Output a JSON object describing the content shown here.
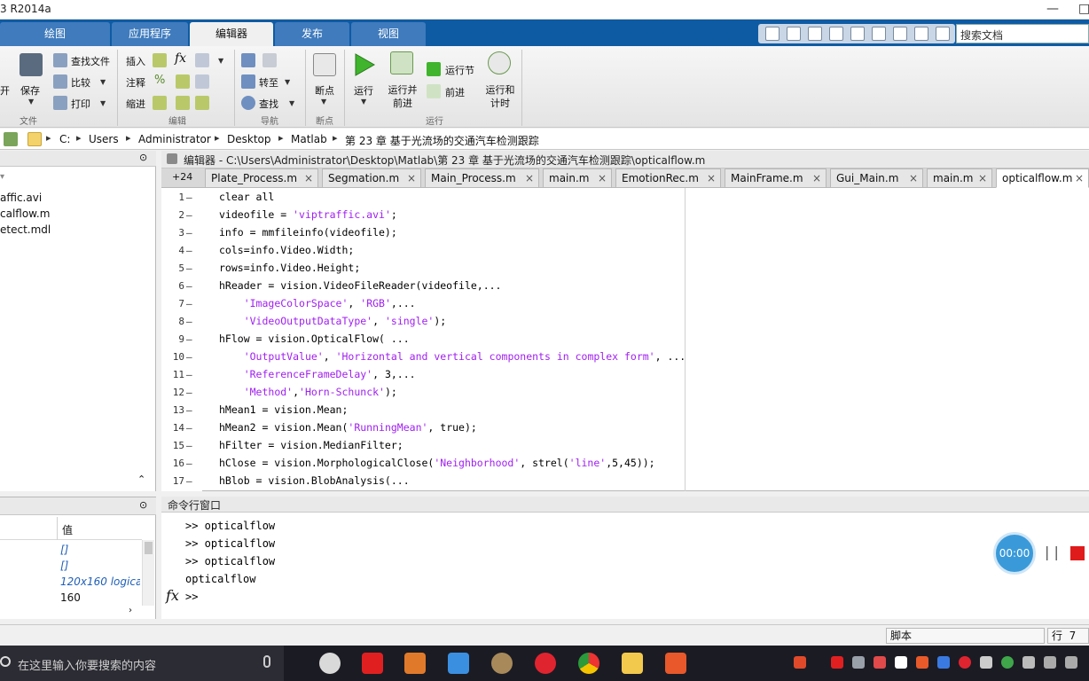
{
  "window": {
    "title": "3 R2014a",
    "minimize": "—",
    "restore": "□"
  },
  "tabs": [
    "绘图",
    "应用程序",
    "编辑器",
    "发布",
    "视图"
  ],
  "search_doc_placeholder": "搜索文档",
  "ribbon": {
    "file_group": {
      "open_partial": "开",
      "save": "保存",
      "find_files": "查找文件",
      "compare": "比较",
      "print": "打印",
      "label": "文件"
    },
    "edit_group": {
      "insert": "插入",
      "comment": "注释",
      "indent": "缩进",
      "fx": "fx",
      "percent": "%",
      "label": "编辑"
    },
    "nav_group": {
      "goto": "转至",
      "find": "查找",
      "label": "导航"
    },
    "bp_group": {
      "breakpoint": "断点",
      "label": "断点"
    },
    "run_group": {
      "run": "运行",
      "run_advance": "运行并\n前进",
      "run_section": "运行节",
      "advance": "前进",
      "run_time": "运行和\n计时",
      "label": "运行"
    }
  },
  "path": [
    "C:",
    "Users",
    "Administrator",
    "Desktop",
    "Matlab",
    "第 23 章 基于光流场的交通汽车检测跟踪"
  ],
  "files": [
    "affic.avi",
    "calflow.m",
    "etect.mdl"
  ],
  "workspace": {
    "header_value": "值",
    "values": [
      "[]",
      "[]",
      "120x160 logica",
      "160"
    ]
  },
  "editor": {
    "title": "编辑器 - C:\\Users\\Administrator\\Desktop\\Matlab\\第 23 章 基于光流场的交通汽车检测跟踪\\opticalflow.m",
    "more_tabs": "+24",
    "tabs": [
      "Plate_Process.m",
      "Segmation.m",
      "Main_Process.m",
      "main.m",
      "EmotionRec.m",
      "MainFrame.m",
      "Gui_Main.m",
      "main.m",
      "opticalflow.m"
    ],
    "active_tab": 8,
    "lines": [
      "clear all",
      "videofile = 'viptraffic.avi';",
      "info = mmfileinfo(videofile);",
      "cols=info.Video.Width;",
      "rows=info.Video.Height;",
      "hReader = vision.VideoFileReader(videofile,...",
      "    'ImageColorSpace', 'RGB',...",
      "    'VideoOutputDataType', 'single');",
      "hFlow = vision.OpticalFlow( ...",
      "    'OutputValue', 'Horizontal and vertical components in complex form', ...",
      "    'ReferenceFrameDelay', 3,...",
      "    'Method','Horn-Schunck');",
      "hMean1 = vision.Mean;",
      "hMean2 = vision.Mean('RunningMean', true);",
      "hFilter = vision.MedianFilter;",
      "hClose = vision.MorphologicalClose('Neighborhood', strel('line',5,45));",
      "hBlob = vision.BlobAnalysis(..."
    ]
  },
  "command": {
    "title": "命令行窗口",
    "lines": [
      ">> opticalflow",
      ">> opticalflow",
      ">> opticalflow",
      "opticalflow"
    ],
    "prompt": ">>",
    "fx": "fx"
  },
  "status": {
    "mode": "脚本",
    "row_label": "行",
    "row": "7"
  },
  "recorder": {
    "time": "00:00"
  },
  "taskbar": {
    "search_placeholder": "在这里输入你要搜索的内容"
  }
}
